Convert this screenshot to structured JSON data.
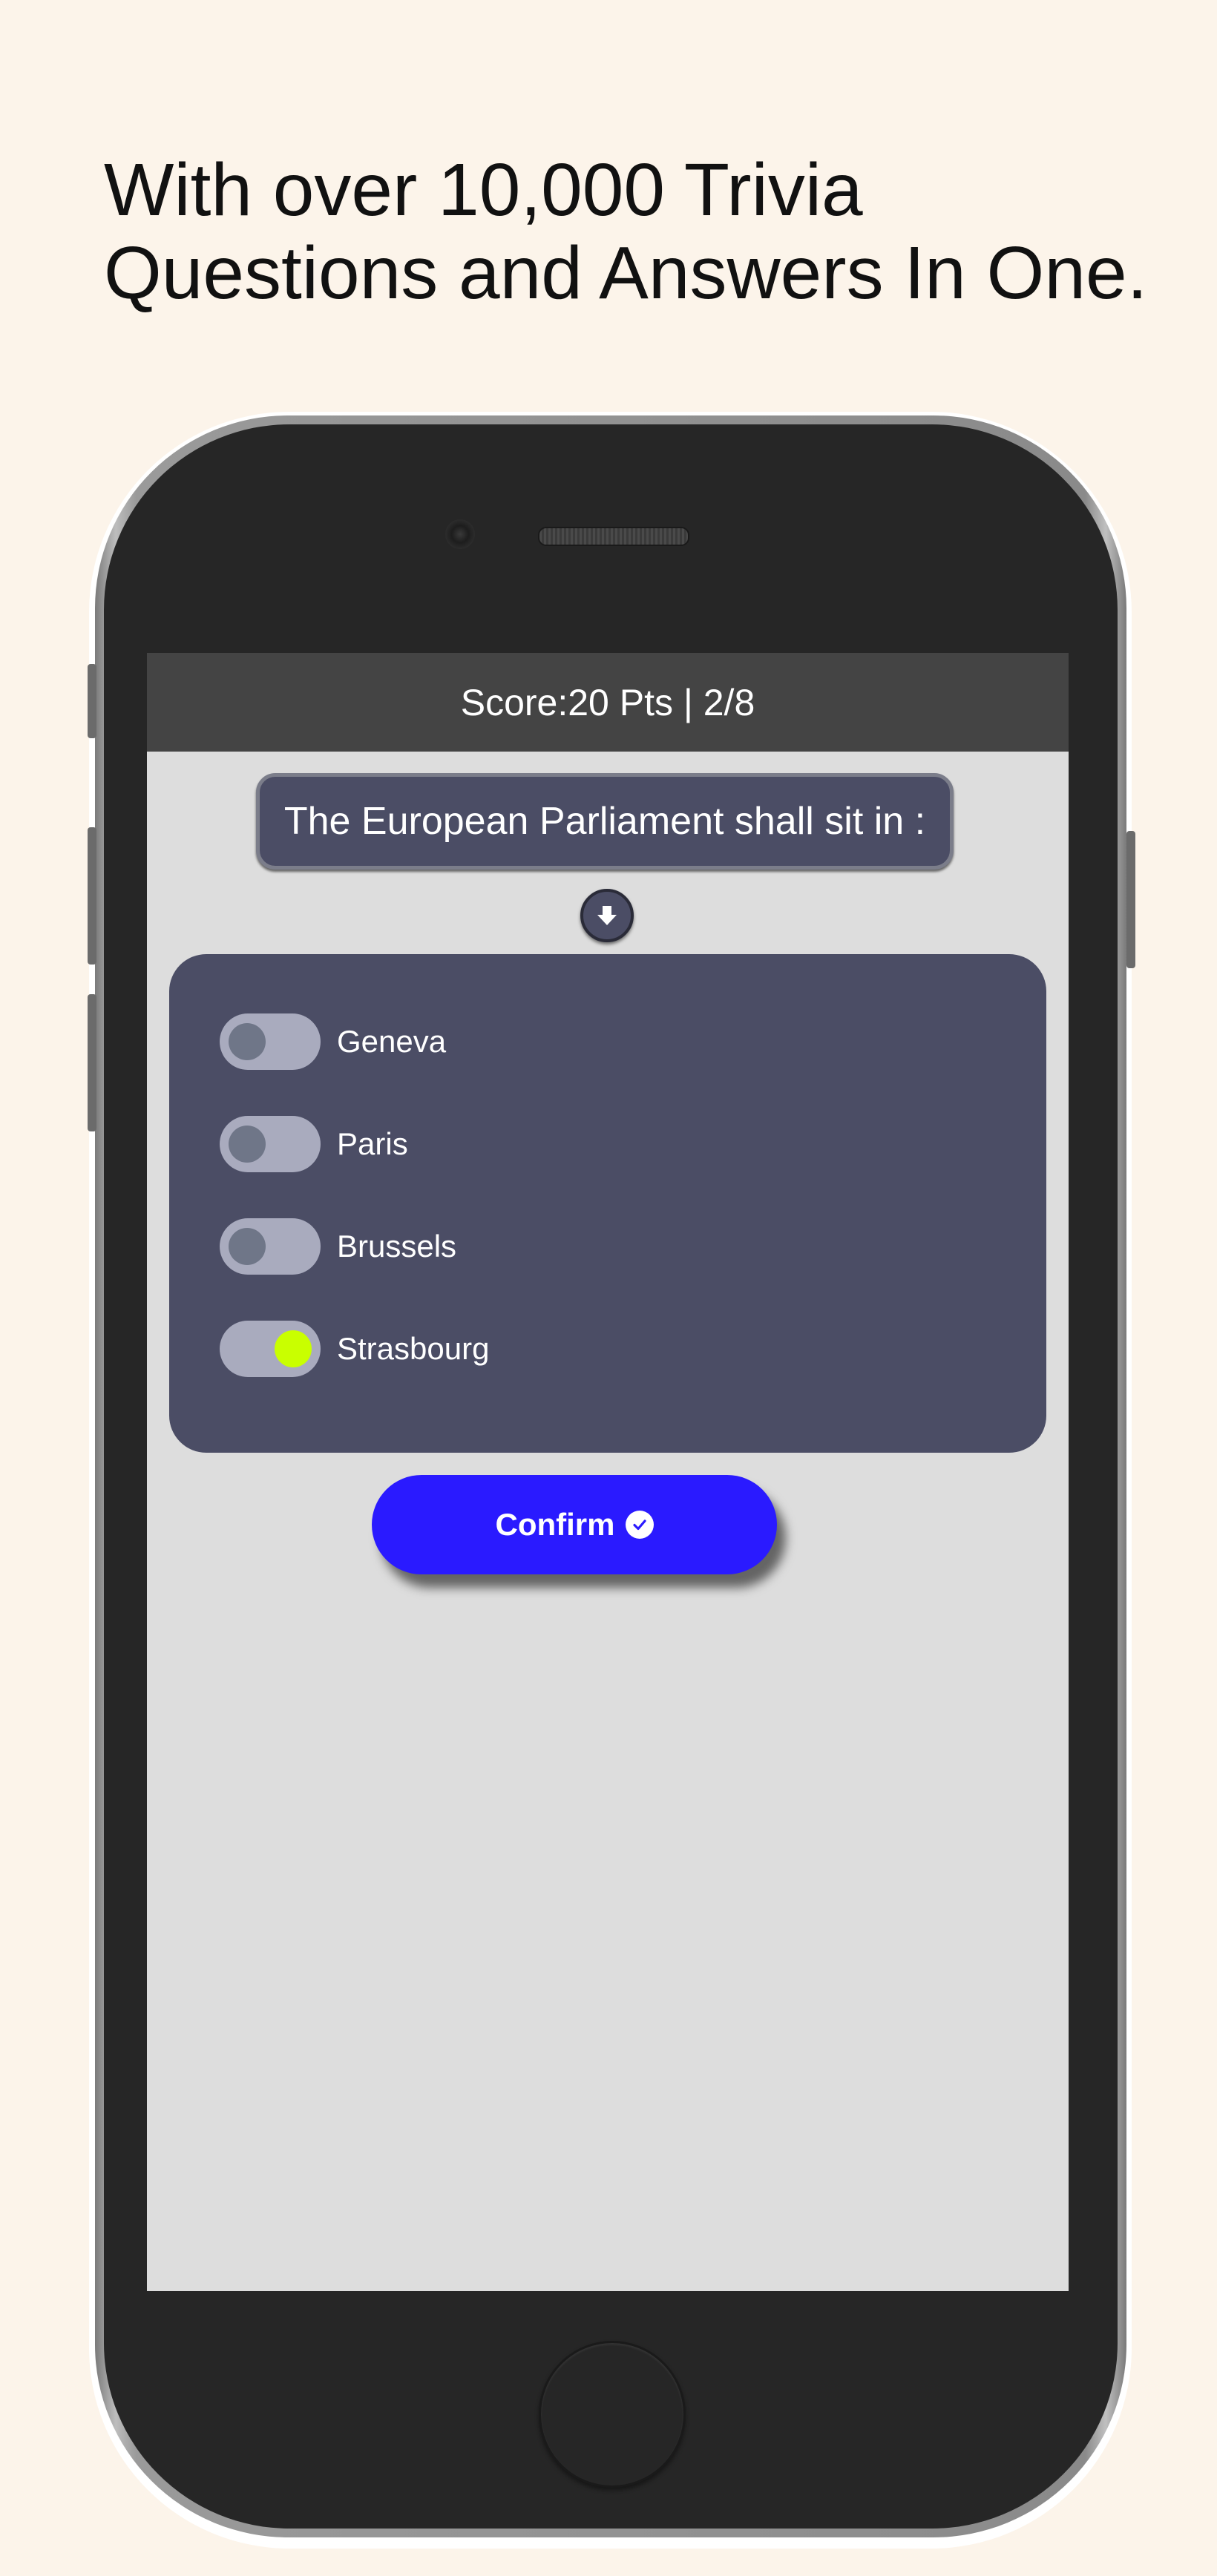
{
  "headline": {
    "line1": "With over 10,000 Trivia",
    "line2": "Questions and Answers In One."
  },
  "app": {
    "score_text": "Score:20 Pts | 2/8",
    "question": "The European Parliament shall sit in :",
    "options": [
      {
        "label": "Geneva",
        "selected": false
      },
      {
        "label": "Paris",
        "selected": false
      },
      {
        "label": "Brussels",
        "selected": false
      },
      {
        "label": "Strasbourg",
        "selected": true
      }
    ],
    "confirm_label": "Confirm",
    "icons": {
      "down": "arrow-down-icon",
      "confirm": "check-circle-icon"
    },
    "colors": {
      "panel": "#4b4d65",
      "toggle_on": "#c9ff00",
      "confirm": "#2a1aff",
      "score_bar": "#444444"
    }
  }
}
